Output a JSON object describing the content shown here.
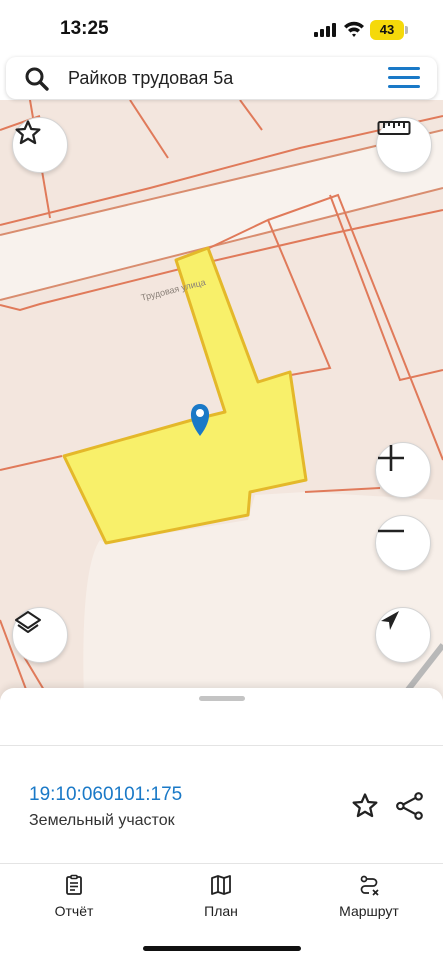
{
  "status_bar": {
    "time": "13:25",
    "battery": "43",
    "icons": [
      "cellular-signal-icon",
      "wifi-icon",
      "battery-icon"
    ]
  },
  "search": {
    "query": "Райков трудовая 5а",
    "icons": [
      "search-icon",
      "hamburger-menu-icon"
    ]
  },
  "map": {
    "street_label": "Трудовая улица",
    "highlight_color": "#f8f06a",
    "highlight_border": "#e4b82a",
    "boundary_color": "#e07a5a",
    "pin_color": "#1a79c7",
    "controls": [
      "favorite-star-icon",
      "ruler-icon",
      "zoom-in-icon",
      "zoom-out-icon",
      "layers-icon",
      "locate-arrow-icon"
    ]
  },
  "parcel": {
    "cadastral_number": "19:10:060101:175",
    "type": "Земельный участок"
  },
  "tabs": [
    {
      "label": "Отчёт",
      "icon": "report-icon"
    },
    {
      "label": "План",
      "icon": "map-plan-icon"
    },
    {
      "label": "Маршрут",
      "icon": "route-icon"
    }
  ],
  "colors": {
    "accent": "#1a79c7"
  }
}
